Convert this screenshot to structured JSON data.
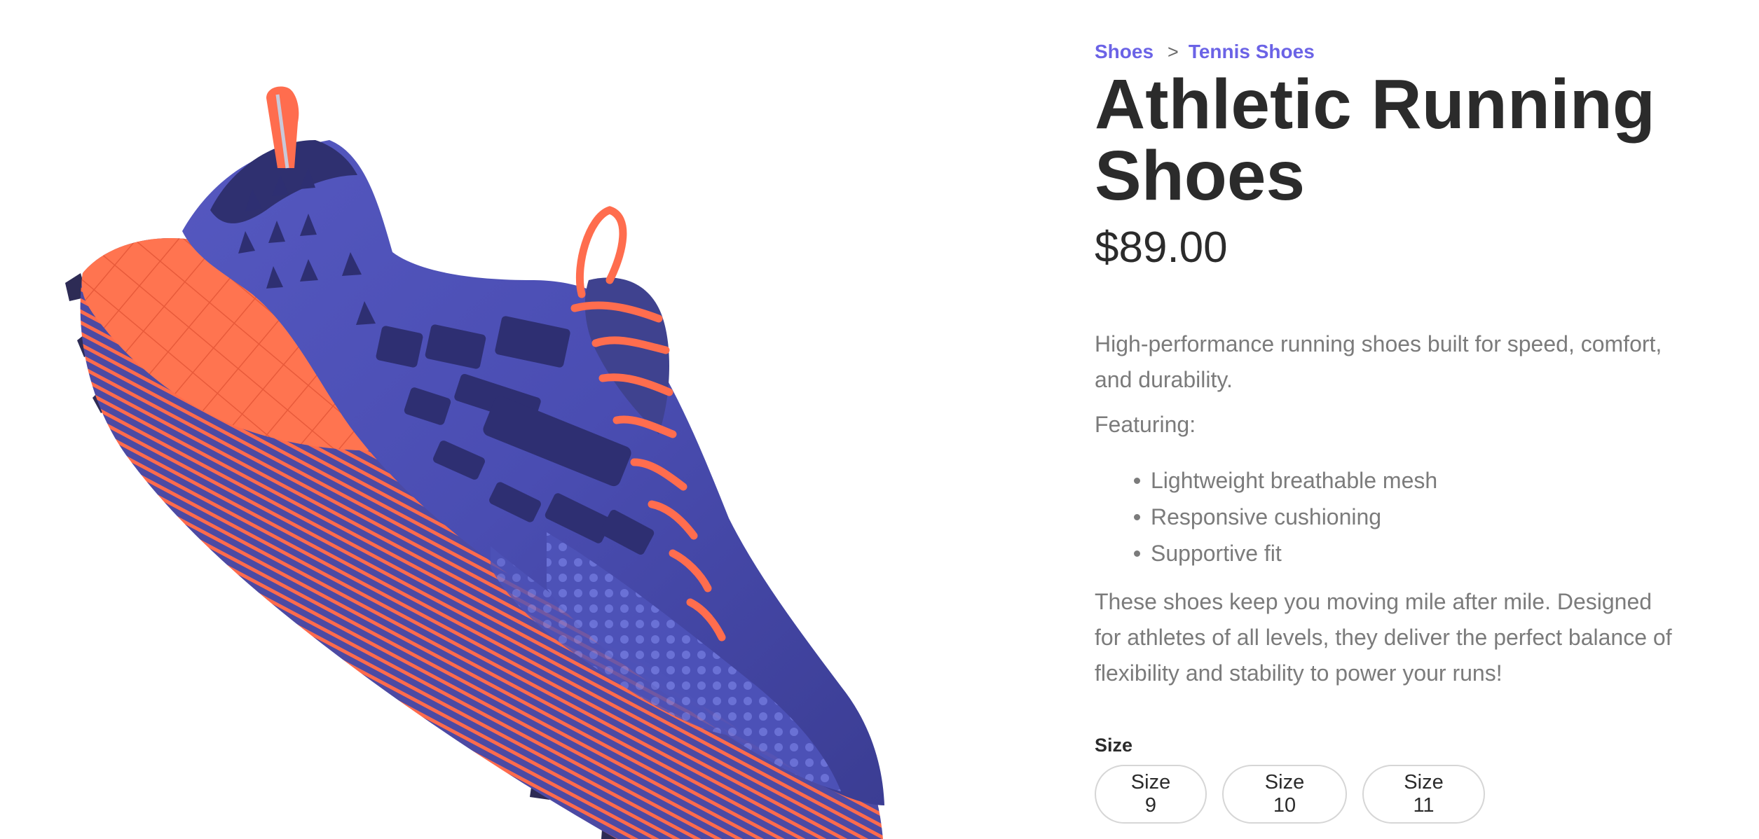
{
  "breadcrumb": {
    "items": [
      "Shoes",
      "Tennis Shoes"
    ],
    "separator": ">"
  },
  "product": {
    "title": "Athletic Running Shoes",
    "price": "$89.00",
    "description": "High-performance running shoes built for speed, comfort, and durability.",
    "featuring_label": "Featuring:",
    "features": [
      "Lightweight breathable mesh",
      "Responsive cushioning",
      "Supportive fit"
    ],
    "closing": "These shoes keep you moving mile after mile. Designed for athletes of all levels, they deliver the perfect balance of flexibility and stability to power your runs!",
    "image_icon": "running-shoe-photo"
  },
  "size_selector": {
    "label": "Size",
    "options": [
      "Size 9",
      "Size 10",
      "Size 11"
    ]
  },
  "colors": {
    "link": "#6b63e6",
    "heading": "#2b2b2b",
    "body_text": "#7b7b7b",
    "shoe_upper": "#4a4fb0",
    "shoe_sole": "#ff6a4a"
  }
}
